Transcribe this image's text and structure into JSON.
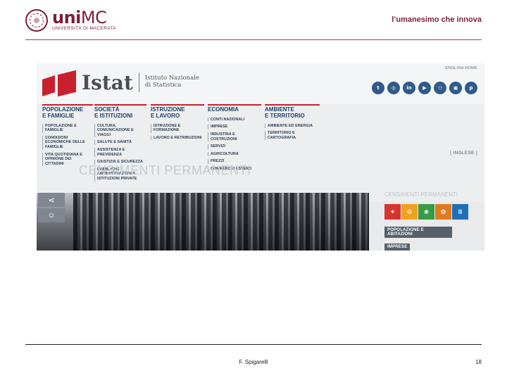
{
  "header": {
    "logo_main_bold": "uni",
    "logo_main_thin": "MC",
    "logo_sub": "UNIVERSITÀ DI MACERATA",
    "tagline": "l’umanesimo che innova",
    "accent": "#7a1f3d"
  },
  "screenshot": {
    "english_home": "ENGLISH HOME",
    "istat_word": "Istat",
    "istat_sub_line1": "Istituto Nazionale",
    "istat_sub_line2": "di Statistica",
    "social": [
      "twitter-icon",
      "instagram-icon",
      "linkedin-icon",
      "youtube-icon",
      "flickr-icon",
      "facebook-icon",
      "pinterest-icon"
    ],
    "social_glyphs": [
      "t",
      "◎",
      "in",
      "▶",
      "⚇",
      "▣",
      "p"
    ],
    "menu": [
      {
        "title": "POPOLAZIONE\nE FAMIGLIE",
        "links": [
          "POPOLAZIONE E\nFAMIGLIE",
          "CONDIZIONI\nECONOMICHE DELLE\nFAMIGLIE",
          "VITA QUOTIDIANA E\nOPINIONE DEI\nCITTADINI"
        ]
      },
      {
        "title": "SOCIETÀ\nE ISTITUZIONI",
        "links": [
          "CULTURA,\nCOMUNICAZIONE E\nVIAGGI",
          "SALUTE E SANITÀ",
          "ASSISTENZA E\nPREVIDENZA",
          "GIUSTIZIA E SICUREZZA",
          "PUBBLICHE\nAMMINISTRAZIONI E\nISTITUZIONI PRIVATE"
        ]
      },
      {
        "title": "ISTRUZIONE\nE LAVORO",
        "links": [
          "ISTRUZIONE E\nFORMAZIONE",
          "LAVORO E RETRIBUZIONI"
        ]
      },
      {
        "title": "ECONOMIA",
        "links": [
          "CONTI NAZIONALI",
          "IMPRESE",
          "INDUSTRIA E\nCOSTRUZIONI",
          "SERVIZI",
          "AGRICOLTURA",
          "PREZZI",
          "COMMERCIO ESTERO"
        ]
      },
      {
        "title": "AMBIENTE\nE TERRITORIO",
        "links": [
          "AMBIENTE ED ENERGIA",
          "TERRITORIO E\nCARTOGRAFIA"
        ]
      }
    ],
    "ghost_title": "CENSIMENTI PERMANENTI",
    "inglese": "[ INGLESE ]",
    "census_label": "CENSIMENTI PERMANENTI",
    "census_tile_colors": [
      "#d8342f",
      "#f0a21c",
      "#3a9a46",
      "#e07b1f",
      "#1f6fb5"
    ],
    "census_tile_glyphs": [
      "✦",
      "⚙",
      "❀",
      "✿",
      "Ⅲ"
    ],
    "census_buttons": [
      "POPOLAZIONE E ABITAZIONI",
      "IMPRESE"
    ]
  },
  "footer": {
    "author": "F. Spigarelli",
    "page": "18"
  }
}
